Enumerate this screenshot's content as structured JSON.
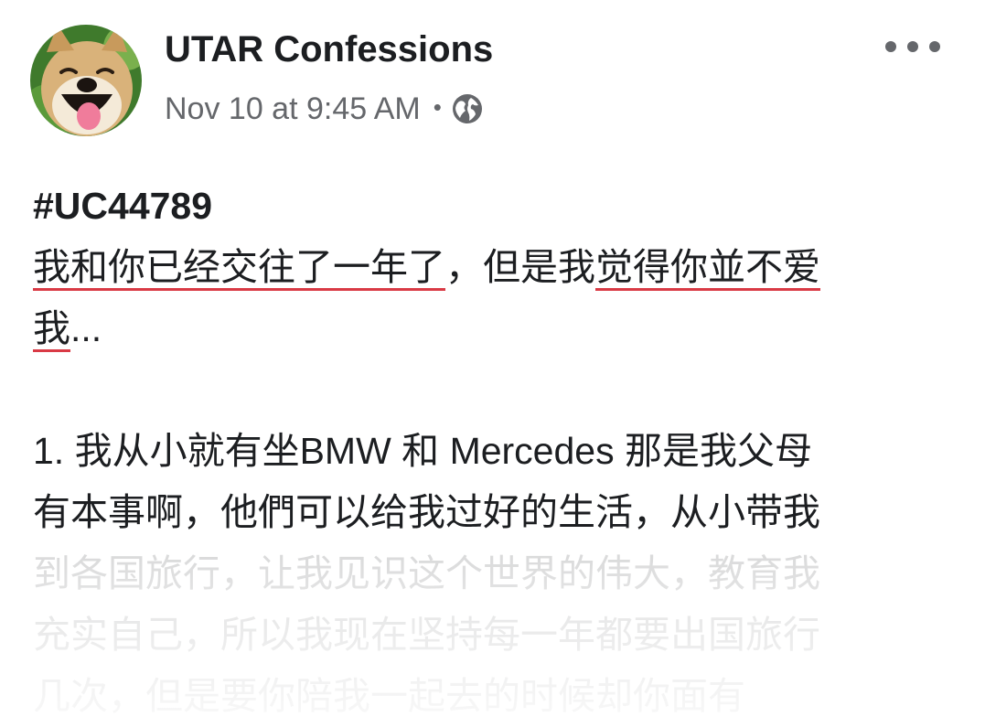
{
  "post": {
    "author": "UTAR Confessions",
    "timestamp": "Nov 10 at 9:45 AM",
    "separator": "•",
    "privacy_icon": "globe-icon",
    "more_icon": "more-options-icon",
    "avatar_icon": "shiba-dog-avatar"
  },
  "content": {
    "hashtag": "#UC44789",
    "intro": {
      "l1_a": "我和你已经交往了一年了",
      "l1_b": "，但是我",
      "l1_c": "觉得你並不爱",
      "l2_a": "我",
      "l2_b": "..."
    },
    "para1": [
      "1. 我从小就有坐BMW 和 Mercedes 那是我父母",
      "有本事啊，他們可以给我过好的生活，从小带我",
      "到各国旅行，让我见识这个世界的伟大，教育我",
      "充实自己，所以我现在坚持每一年都要出国旅行",
      "几次，但是要你陪我一起去的时候却你面有"
    ]
  },
  "colors": {
    "text": "#1c1e21",
    "secondary_text": "#65676b",
    "underline": "#d93a45",
    "background": "#ffffff"
  }
}
